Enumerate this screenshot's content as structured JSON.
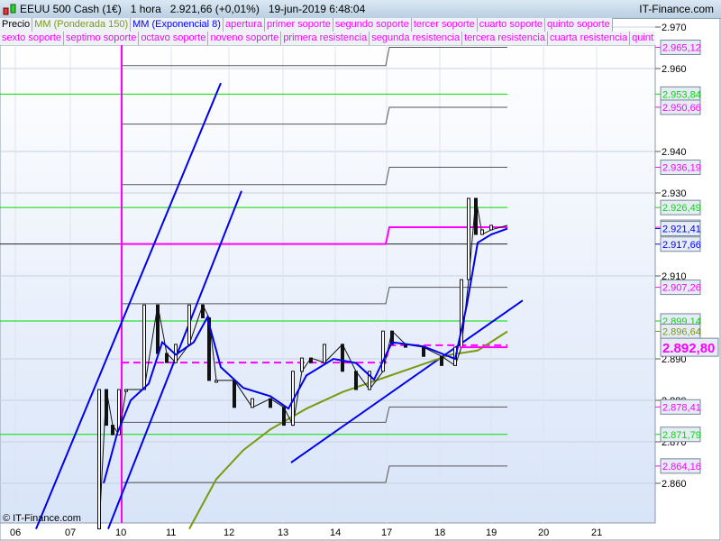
{
  "header": {
    "title": "EEUU 500 Cash (1€)   1 hora   2.921,66 (+0,01%)   19-jun-2019 6:48:04",
    "brand": "IT-Finance.com"
  },
  "legend_row1": [
    {
      "t": "Precio",
      "c": "#000000"
    },
    {
      "t": "MM (Ponderada 150)",
      "c": "#7a9a10"
    },
    {
      "t": "MM (Exponencial 8)",
      "c": "#0000ff"
    },
    {
      "t": "apertura",
      "c": "#ff00ff"
    },
    {
      "t": "primer soporte",
      "c": "#ff00ff"
    },
    {
      "t": "segundo soporte",
      "c": "#ff00ff"
    },
    {
      "t": "tercer soporte",
      "c": "#ff00ff"
    },
    {
      "t": "cuarto soporte",
      "c": "#ff00ff"
    },
    {
      "t": "quinto soporte",
      "c": "#ff00ff"
    }
  ],
  "legend_row2": [
    {
      "t": "sexto soporte",
      "c": "#ff00ff"
    },
    {
      "t": "septimo soporte",
      "c": "#ff00ff"
    },
    {
      "t": "octavo soporte",
      "c": "#ff00ff"
    },
    {
      "t": "noveno soporte",
      "c": "#ff00ff"
    },
    {
      "t": "primera resistencia",
      "c": "#ff00ff"
    },
    {
      "t": "segunda resistencia",
      "c": "#ff00ff"
    },
    {
      "t": "tercera resistencia",
      "c": "#ff00ff"
    },
    {
      "t": "cuarta resistencia",
      "c": "#ff00ff"
    },
    {
      "t": "quint",
      "c": "#ff00ff"
    }
  ],
  "watermark": "© IT-Finance.com",
  "chart_data": {
    "type": "line",
    "title": "EEUU 500 Cash (1€) 1 hora",
    "ylim": [
      2.85,
      2.97
    ],
    "y_ticks": [
      "2.970",
      "2.960",
      "2.940",
      "2.930",
      "2.910",
      "2.890",
      "2.880",
      "2.870",
      "2.860"
    ],
    "y_tick_values": [
      2.97,
      2.96,
      2.94,
      2.93,
      2.91,
      2.89,
      2.88,
      2.87,
      2.86
    ],
    "x_ticks": [
      "06",
      "07",
      "10",
      "11",
      "12",
      "13",
      "14",
      "17",
      "18",
      "19",
      "20",
      "21"
    ],
    "last_price": {
      "label": "2.892,80",
      "value": 2.8928,
      "color": "#ff00ff"
    },
    "labels": [
      {
        "t": "2.965,12",
        "v": 2.96512,
        "c": "#ff00ff"
      },
      {
        "t": "2.953,84",
        "v": 2.95384,
        "c": "#00dd00"
      },
      {
        "t": "2.950,66",
        "v": 2.95066,
        "c": "#ff00ff"
      },
      {
        "t": "2.936,19",
        "v": 2.93619,
        "c": "#ff00ff"
      },
      {
        "t": "2.926,49",
        "v": 2.92649,
        "c": "#00dd00"
      },
      {
        "t": "2.921,73",
        "v": 2.92173,
        "c": "#ff00ff"
      },
      {
        "t": "2.921,41",
        "v": 2.92141,
        "c": "#0000ff"
      },
      {
        "t": "2.917,66",
        "v": 2.91766,
        "c": "#0000ff"
      },
      {
        "t": "2.907,26",
        "v": 2.90726,
        "c": "#ff00ff"
      },
      {
        "t": "2.899,14",
        "v": 2.89914,
        "c": "#00dd00"
      },
      {
        "t": "2.896,64",
        "v": 2.89664,
        "c": "#7a9a10"
      },
      {
        "t": "2.878,41",
        "v": 2.87841,
        "c": "#ff00ff"
      },
      {
        "t": "2.871,79",
        "v": 2.87179,
        "c": "#00dd00"
      },
      {
        "t": "2.864,16",
        "v": 2.86416,
        "c": "#ff00ff"
      }
    ],
    "green_levels": [
      2.95384,
      2.92649,
      2.89914,
      2.87179
    ],
    "step_levels": [
      [
        2.9607,
        2.96512
      ],
      [
        2.9466,
        2.95066
      ],
      [
        2.932,
        2.93619
      ],
      [
        2.9177,
        2.92173
      ],
      [
        2.9033,
        2.90726
      ],
      [
        2.8891,
        2.8933
      ],
      [
        2.8747,
        2.87841
      ],
      [
        2.8602,
        2.86416
      ]
    ],
    "price": [
      [
        110,
        2.849
      ],
      [
        118,
        2.8826
      ],
      [
        125,
        2.874
      ],
      [
        132,
        2.8717
      ],
      [
        140,
        2.8826
      ],
      [
        160,
        2.8826
      ],
      [
        175,
        2.903
      ],
      [
        185,
        2.8913
      ],
      [
        195,
        2.8891
      ],
      [
        210,
        2.8935
      ],
      [
        225,
        2.903
      ],
      [
        232,
        2.8999
      ],
      [
        240,
        2.8848
      ],
      [
        260,
        2.8848
      ],
      [
        280,
        2.8783
      ],
      [
        300,
        2.8804
      ],
      [
        315,
        2.8783
      ],
      [
        325,
        2.874
      ],
      [
        335,
        2.887
      ],
      [
        345,
        2.8902
      ],
      [
        360,
        2.8891
      ],
      [
        380,
        2.8935
      ],
      [
        395,
        2.887
      ],
      [
        410,
        2.8826
      ],
      [
        425,
        2.887
      ],
      [
        435,
        2.8967
      ],
      [
        450,
        2.8935
      ],
      [
        470,
        2.8928
      ],
      [
        490,
        2.8906
      ],
      [
        505,
        2.8884
      ],
      [
        512,
        2.8928
      ],
      [
        520,
        2.9091
      ],
      [
        528,
        2.9287
      ],
      [
        535,
        2.92
      ],
      [
        545,
        2.9211
      ],
      [
        563,
        2.9222
      ]
    ],
    "ema8": [
      [
        115,
        2.86
      ],
      [
        130,
        2.872
      ],
      [
        145,
        2.88
      ],
      [
        165,
        2.884
      ],
      [
        180,
        2.894
      ],
      [
        195,
        2.891
      ],
      [
        215,
        2.894
      ],
      [
        230,
        2.9
      ],
      [
        245,
        2.888
      ],
      [
        270,
        2.883
      ],
      [
        300,
        2.881
      ],
      [
        320,
        2.878
      ],
      [
        340,
        2.886
      ],
      [
        370,
        2.89
      ],
      [
        395,
        2.889
      ],
      [
        415,
        2.885
      ],
      [
        435,
        2.894
      ],
      [
        470,
        2.893
      ],
      [
        505,
        2.89
      ],
      [
        518,
        2.903
      ],
      [
        530,
        2.918
      ],
      [
        545,
        2.92
      ],
      [
        563,
        2.9214
      ]
    ],
    "ma150": [
      [
        210,
        2.849
      ],
      [
        240,
        2.861
      ],
      [
        270,
        2.868
      ],
      [
        300,
        2.873
      ],
      [
        340,
        2.878
      ],
      [
        380,
        2.882
      ],
      [
        420,
        2.885
      ],
      [
        460,
        2.888
      ],
      [
        500,
        2.891
      ],
      [
        530,
        2.892
      ],
      [
        563,
        2.8966
      ]
    ],
    "trendlines": [
      [
        [
          40,
          2.849
        ],
        [
          245,
          2.9565
        ]
      ],
      [
        [
          120,
          2.849
        ],
        [
          268,
          2.9305
        ]
      ],
      [
        [
          323,
          2.865
        ],
        [
          580,
          2.9041
        ]
      ]
    ]
  }
}
